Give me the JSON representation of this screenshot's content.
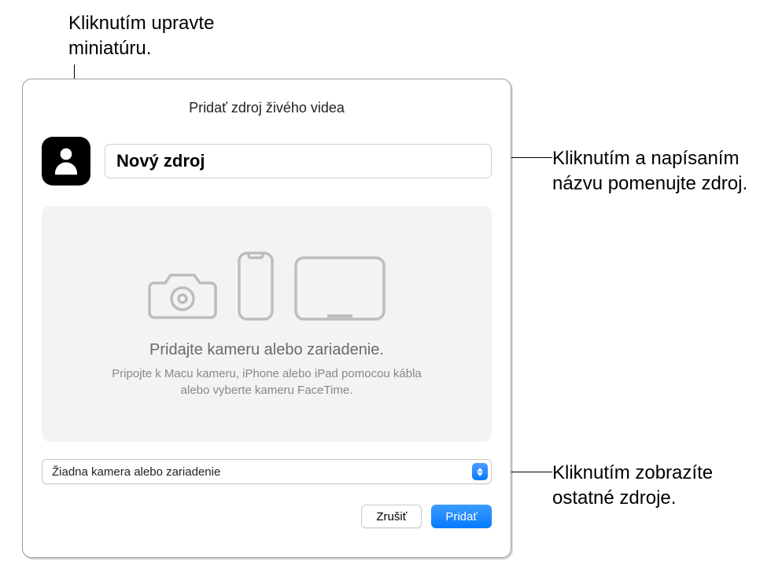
{
  "callouts": {
    "thumbnail": "Kliknutím upravte miniatúru.",
    "name": "Kliknutím a napísaním názvu pomenujte zdroj.",
    "dropdown": "Kliknutím zobrazíte ostatné zdroje."
  },
  "dialog": {
    "title": "Pridať zdroj živého videa",
    "source_name": "Nový zdroj",
    "preview": {
      "title": "Pridajte kameru alebo zariadenie.",
      "subtitle": "Pripojte k Macu kameru, iPhone alebo iPad pomocou kábla alebo vyberte kameru FaceTime."
    },
    "dropdown_label": "Žiadna kamera alebo zariadenie",
    "buttons": {
      "cancel": "Zrušiť",
      "add": "Pridať"
    }
  }
}
